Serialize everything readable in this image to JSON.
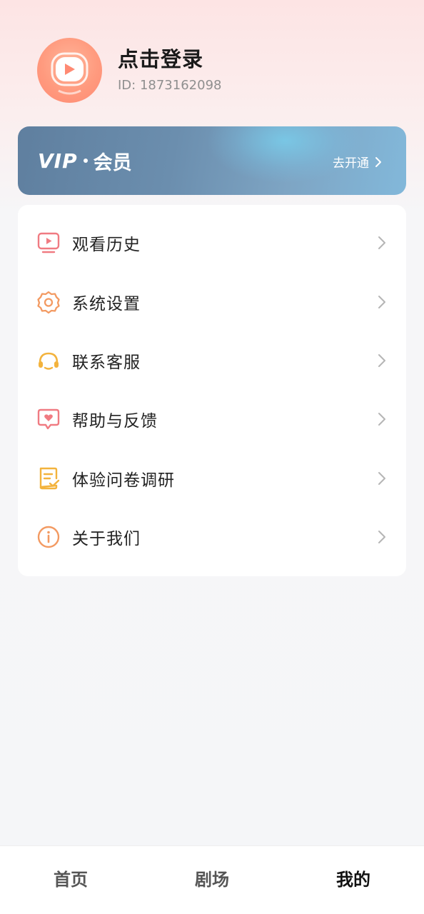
{
  "profile": {
    "login_label": "点击登录",
    "user_id": "ID: 1873162098",
    "avatar_icon": "play-tv-avatar-icon"
  },
  "vip": {
    "logo_text": "VIP",
    "member_text": "会员",
    "action_label": "去开通",
    "action_icon": "chevron-right-icon"
  },
  "menu": {
    "items": [
      {
        "label": "观看历史",
        "icon": "tv-history-icon",
        "color": "#f07b82"
      },
      {
        "label": "系统设置",
        "icon": "gear-icon",
        "color": "#f39a62"
      },
      {
        "label": "联系客服",
        "icon": "headset-icon",
        "color": "#f3b33d"
      },
      {
        "label": "帮助与反馈",
        "icon": "heart-chat-icon",
        "color": "#f07b82"
      },
      {
        "label": "体验问卷调研",
        "icon": "survey-icon",
        "color": "#f3b33d"
      },
      {
        "label": "关于我们",
        "icon": "info-icon",
        "color": "#f39a62"
      }
    ]
  },
  "bottom_nav": {
    "items": [
      {
        "label": "首页",
        "active": false
      },
      {
        "label": "剧场",
        "active": false
      },
      {
        "label": "我的",
        "active": true
      }
    ]
  }
}
